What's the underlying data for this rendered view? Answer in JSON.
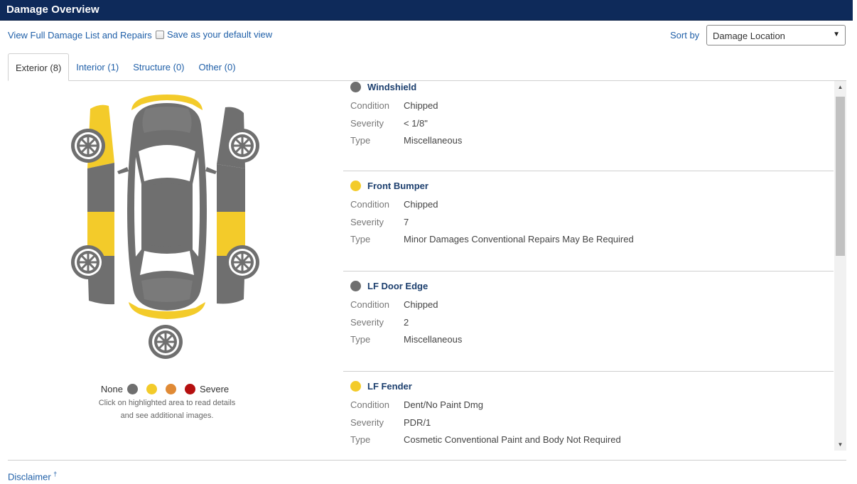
{
  "header": {
    "title": "Damage Overview"
  },
  "toolbar": {
    "full_list_link": "View Full Damage List and Repairs",
    "save_default_label": "Save as your default view",
    "save_default_checked": false,
    "sort_label": "Sort by",
    "sort_value": "Damage Location"
  },
  "tabs": [
    {
      "label": "Exterior (8)",
      "active": true
    },
    {
      "label": "Interior (1)",
      "active": false
    },
    {
      "label": "Structure (0)",
      "active": false
    },
    {
      "label": "Other (0)",
      "active": false
    }
  ],
  "colors": {
    "none": "#6f6f6f",
    "minor": "#f3cb2a",
    "moderate": "#e08a35",
    "severe": "#b50f0f"
  },
  "legend": {
    "none_label": "None",
    "severe_label": "Severe",
    "note_line1": "Click on highlighted area to read details",
    "note_line2": "and see additional images."
  },
  "damage_items": [
    {
      "name": "Windshield",
      "level": "none",
      "fields": [
        {
          "label": "Condition",
          "value": "Chipped"
        },
        {
          "label": "Severity",
          "value": "< 1/8\""
        },
        {
          "label": "Type",
          "value": "Miscellaneous"
        }
      ]
    },
    {
      "name": "Front Bumper",
      "level": "minor",
      "fields": [
        {
          "label": "Condition",
          "value": "Chipped"
        },
        {
          "label": "Severity",
          "value": "7"
        },
        {
          "label": "Type",
          "value": "Minor Damages Conventional Repairs May Be Required"
        }
      ]
    },
    {
      "name": "LF Door Edge",
      "level": "none",
      "fields": [
        {
          "label": "Condition",
          "value": "Chipped"
        },
        {
          "label": "Severity",
          "value": "2"
        },
        {
          "label": "Type",
          "value": "Miscellaneous"
        }
      ]
    },
    {
      "name": "LF Fender",
      "level": "minor",
      "fields": [
        {
          "label": "Condition",
          "value": "Dent/No Paint Dmg"
        },
        {
          "label": "Severity",
          "value": "PDR/1"
        },
        {
          "label": "Type",
          "value": "Cosmetic Conventional Paint and Body Not Required"
        }
      ]
    }
  ],
  "footer": {
    "disclaimer": "Disclaimer",
    "disclaimer_mark": "†"
  }
}
